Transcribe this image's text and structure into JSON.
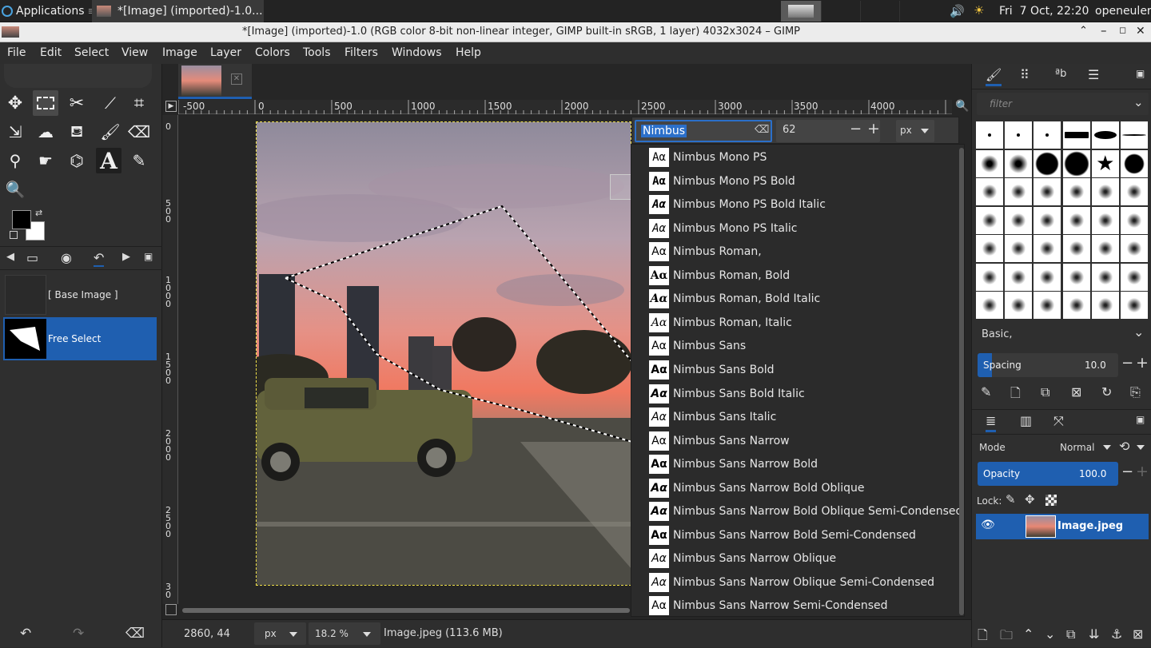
{
  "taskbar": {
    "applications_label": "Applications",
    "task_title": "*[Image] (imported)-1.0...",
    "clock": "Fri  7 Oct, 22:20",
    "user": "openeuler"
  },
  "window": {
    "title": "*[Image] (imported)-1.0 (RGB color 8-bit non-linear integer, GIMP built-in sRGB, 1 layer) 4032x3024 – GIMP"
  },
  "menu": [
    "File",
    "Edit",
    "Select",
    "View",
    "Image",
    "Layer",
    "Colors",
    "Tools",
    "Filters",
    "Windows",
    "Help"
  ],
  "undo_history": [
    {
      "label": "[ Base Image ]",
      "selected": false
    },
    {
      "label": "Free Select",
      "selected": true
    }
  ],
  "ruler": {
    "h_ticks": [
      "-500",
      "0",
      "500",
      "1000",
      "1500",
      "2000",
      "2500",
      "3000",
      "3500",
      "4000"
    ],
    "v_ticks": [
      "0",
      "500",
      "1000",
      "1500",
      "2000",
      "2500",
      "3000"
    ]
  },
  "text_tool": {
    "font_query": "Nimbus",
    "size_value": "62",
    "size_unit": "px"
  },
  "font_list": [
    {
      "name": "Nimbus Mono PS",
      "sample": "Aα"
    },
    {
      "name": "Nimbus Mono PS Bold",
      "sample": "Aα"
    },
    {
      "name": "Nimbus Mono PS Bold Italic",
      "sample": "Aα"
    },
    {
      "name": "Nimbus Mono PS Italic",
      "sample": "Aα"
    },
    {
      "name": "Nimbus Roman,",
      "sample": "Aα"
    },
    {
      "name": "Nimbus Roman, Bold",
      "sample": "Aα"
    },
    {
      "name": "Nimbus Roman, Bold Italic",
      "sample": "Aα"
    },
    {
      "name": "Nimbus Roman, Italic",
      "sample": "Aα"
    },
    {
      "name": "Nimbus Sans",
      "sample": "Aα"
    },
    {
      "name": "Nimbus Sans Bold",
      "sample": "Aα"
    },
    {
      "name": "Nimbus Sans Bold Italic",
      "sample": "Aα"
    },
    {
      "name": "Nimbus Sans Italic",
      "sample": "Aα"
    },
    {
      "name": "Nimbus Sans Narrow",
      "sample": "Aα"
    },
    {
      "name": "Nimbus Sans Narrow Bold",
      "sample": "Aα"
    },
    {
      "name": "Nimbus Sans Narrow Bold Oblique",
      "sample": "Aα"
    },
    {
      "name": "Nimbus Sans Narrow Bold Oblique Semi-Condensed",
      "sample": "Aα"
    },
    {
      "name": "Nimbus Sans Narrow Bold Semi-Condensed",
      "sample": "Aα"
    },
    {
      "name": "Nimbus Sans Narrow Oblique",
      "sample": "Aα"
    },
    {
      "name": "Nimbus Sans Narrow Oblique Semi-Condensed",
      "sample": "Aα"
    },
    {
      "name": "Nimbus Sans Narrow Semi-Condensed",
      "sample": "Aα"
    }
  ],
  "status": {
    "coords": "2860, 44",
    "unit": "px",
    "zoom": "18.2 %",
    "file_info": "Image.jpeg (113.6 MB)"
  },
  "brushes": {
    "filter_placeholder": "filter",
    "preset": "Basic,",
    "spacing_label": "Spacing",
    "spacing_value": "10.0"
  },
  "layers": {
    "mode_label": "Mode",
    "mode_value": "Normal",
    "opacity_label": "Opacity",
    "opacity_value": "100.0",
    "lock_label": "Lock:",
    "items": [
      {
        "name": "Image.jpeg",
        "visible": true
      }
    ]
  },
  "colors": {
    "accent": "#1f5fb0",
    "selection_highlight": "#2b6fc9"
  }
}
